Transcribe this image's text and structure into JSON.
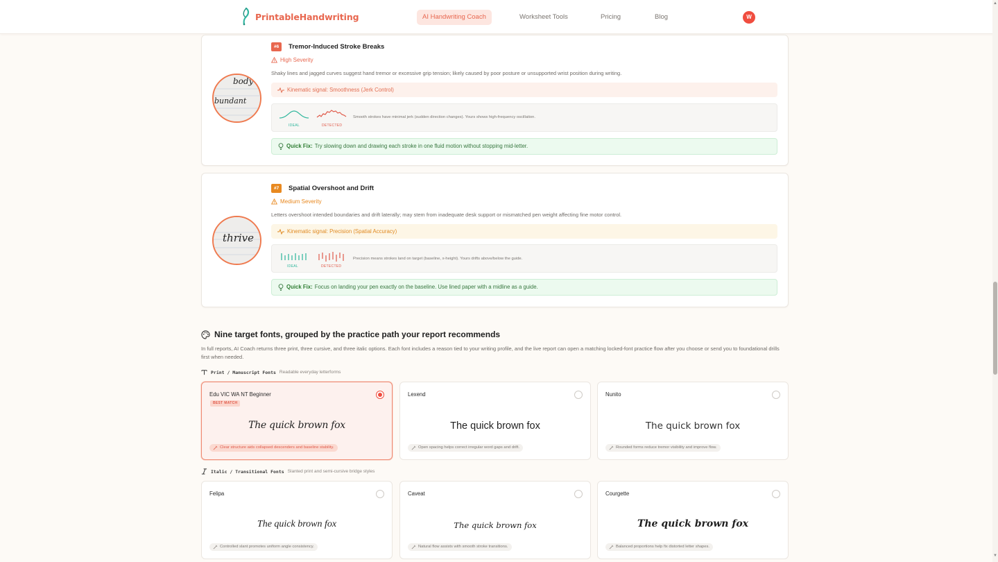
{
  "nav": {
    "brand": "PrintableHandwriting",
    "links": [
      {
        "label": "AI Handwriting Coach",
        "active": true
      },
      {
        "label": "Worksheet Tools",
        "active": false
      },
      {
        "label": "Pricing",
        "active": false
      },
      {
        "label": "Blog",
        "active": false
      }
    ],
    "avatar_initial": "W"
  },
  "issues": [
    {
      "badge": "#6",
      "title": "Tremor-Induced Stroke Breaks",
      "severity": "High Severity",
      "description": "Shaky lines and jagged curves suggest hand tremor or excessive grip tension; likely caused by poor posture or unsupported wrist position during writing.",
      "signal": "Kinematic signal: Smoothness (Jerk Control)",
      "viz_ideal": "IDEAL",
      "viz_detected": "DETECTED",
      "viz_text": "Smooth strokes have minimal jerk (sudden direction changes). Yours shows high-frequency oscillation.",
      "fix_label": "Quick Fix:",
      "fix_text": "Try slowing down and drawing each stroke in one fluid motion without stopping mid-letter.",
      "thumb_words": [
        "body",
        "bundant"
      ]
    },
    {
      "badge": "#7",
      "title": "Spatial Overshoot and Drift",
      "severity": "Medium Severity",
      "description": "Letters overshoot intended boundaries and drift laterally; may stem from inadequate desk support or mismatched pen weight affecting fine motor control.",
      "signal": "Kinematic signal: Precision (Spatial Accuracy)",
      "viz_ideal": "IDEAL",
      "viz_detected": "DETECTED",
      "viz_text": "Precision means strokes land on target (baseline, x-height). Yours drifts above/below the guide.",
      "fix_label": "Quick Fix:",
      "fix_text": "Focus on landing your pen exactly on the baseline. Use lined paper with a midline as a guide.",
      "thumb_words": [
        "thrive"
      ]
    }
  ],
  "fonts_section": {
    "title": "Nine target fonts, grouped by the practice path your report recommends",
    "description": "In full reports, AI Coach returns three print, three cursive, and three italic options. Each font includes a reason tied to your writing profile, and the live report can open a matching locked-font practice flow after you choose or send you to foundational drills first when needed.",
    "groups": [
      {
        "name": "Print / Manuscript Fonts",
        "subtitle": "Readable everyday letterforms",
        "fonts": [
          {
            "name": "Edu VIC WA NT Beginner",
            "badge": "BEST MATCH",
            "selected": true,
            "sample": "The quick brown fox",
            "reason": "Clear structure aids collapsed descenders and baseline stability."
          },
          {
            "name": "Lexend",
            "badge": "",
            "selected": false,
            "sample": "The quick brown fox",
            "reason": "Open spacing helps correct irregular word gaps and drift."
          },
          {
            "name": "Nunito",
            "badge": "",
            "selected": false,
            "sample": "The quick brown fox",
            "reason": "Rounded forms reduce tremor visibility and improve flow."
          }
        ]
      },
      {
        "name": "Italic / Transitional Fonts",
        "subtitle": "Slanted print and semi-cursive bridge styles",
        "fonts": [
          {
            "name": "Felipa",
            "badge": "",
            "selected": false,
            "sample": "The quick brown fox",
            "reason": "Controlled slant promotes uniform angle consistency."
          },
          {
            "name": "Caveat",
            "badge": "",
            "selected": false,
            "sample": "The quick brown fox",
            "reason": "Natural flow assists with smooth stroke transitions."
          },
          {
            "name": "Courgette",
            "badge": "",
            "selected": false,
            "sample": "The quick brown fox",
            "reason": "Balanced proportions help fix distorted letter shapes."
          }
        ]
      }
    ]
  },
  "colors": {
    "brand": "#e8674f",
    "ideal": "#2ab59a",
    "detected": "#e05a4a",
    "high_severity": "#e8674f",
    "medium_severity": "#e88920",
    "fix_green": "#2e7d32"
  }
}
